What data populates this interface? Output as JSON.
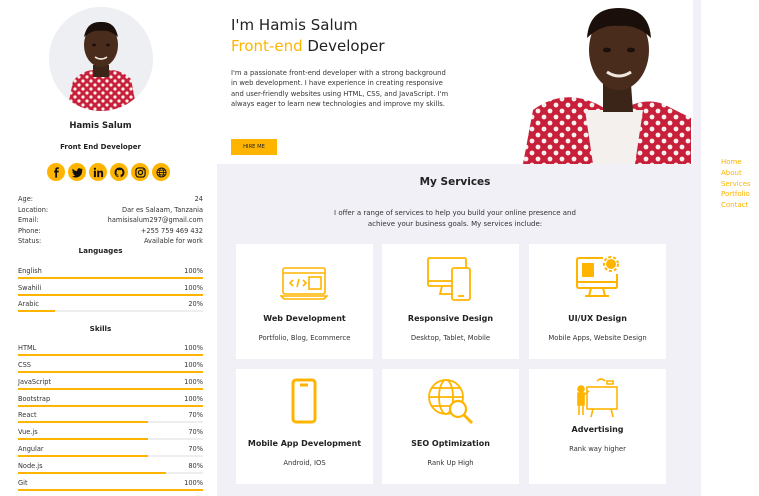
{
  "profile": {
    "name": "Hamis Salum",
    "role": "Front End Developer"
  },
  "socials": [
    {
      "icon": "facebook-icon"
    },
    {
      "icon": "twitter-icon"
    },
    {
      "icon": "linkedin-icon"
    },
    {
      "icon": "github-icon"
    },
    {
      "icon": "instagram-icon"
    },
    {
      "icon": "globe-icon"
    }
  ],
  "info": [
    {
      "label": "Age:",
      "value": "24"
    },
    {
      "label": "Location:",
      "value": "Dar es Salaam, Tanzania"
    },
    {
      "label": "Email:",
      "value": "hamisisalum297@gmail.com"
    },
    {
      "label": "Phone:",
      "value": "+255 759 469 432"
    },
    {
      "label": "Status:",
      "value": "Available for work"
    }
  ],
  "languages_title": "Languages",
  "languages": [
    {
      "name": "English",
      "level": "100%",
      "fraction": 1.0
    },
    {
      "name": "Swahili",
      "level": "100%",
      "fraction": 1.0
    },
    {
      "name": "Arabic",
      "level": "20%",
      "fraction": 0.2
    }
  ],
  "skills_title": "Skills",
  "skills": [
    {
      "name": "HTML",
      "level": "100%",
      "fraction": 1.0
    },
    {
      "name": "CSS",
      "level": "100%",
      "fraction": 1.0
    },
    {
      "name": "JavaScript",
      "level": "100%",
      "fraction": 1.0
    },
    {
      "name": "Bootstrap",
      "level": "100%",
      "fraction": 1.0
    },
    {
      "name": "React",
      "level": "70%",
      "fraction": 0.7
    },
    {
      "name": "Vue.js",
      "level": "70%",
      "fraction": 0.7
    },
    {
      "name": "Angular",
      "level": "70%",
      "fraction": 0.7
    },
    {
      "name": "Node.js",
      "level": "80%",
      "fraction": 0.8
    },
    {
      "name": "Git",
      "level": "100%",
      "fraction": 1.0
    }
  ],
  "hero": {
    "greeting": "I'm Hamis Salum",
    "role_accent": "Front-end",
    "role_rest": " Developer",
    "paragraph": "I'm a passionate front-end developer with a strong background in web development. I have experience in creating responsive and user-friendly websites using HTML, CSS, and JavaScript. I'm always eager to learn new technologies and improve my skills.",
    "hire_label": "HIRE ME"
  },
  "services": {
    "title": "My Services",
    "intro": "I offer a range of services to help you build your online presence and achieve your business goals. My services include:",
    "items": [
      {
        "title": "Web Development",
        "desc": "Portfolio, Blog, Ecommerce",
        "icon": "code-window-icon"
      },
      {
        "title": "Responsive Design",
        "desc": "Desktop, Tablet, Mobile",
        "icon": "devices-icon"
      },
      {
        "title": "UI/UX Design",
        "desc": "Mobile Apps, Website Design",
        "icon": "design-monitor-icon"
      },
      {
        "title": "Mobile App Development",
        "desc": "Android, IOS",
        "icon": "smartphone-icon"
      },
      {
        "title": "SEO Optimization",
        "desc": "Rank Up High",
        "icon": "globe-search-icon"
      },
      {
        "title": "Advertising",
        "desc": "Rank way higher",
        "icon": "presentation-board-icon"
      }
    ]
  },
  "nav": [
    "Home",
    "About",
    "Services",
    "Portfolio",
    "Contact"
  ],
  "colors": {
    "accent": "#ffb400",
    "panel_bg": "#f0f0f6"
  }
}
